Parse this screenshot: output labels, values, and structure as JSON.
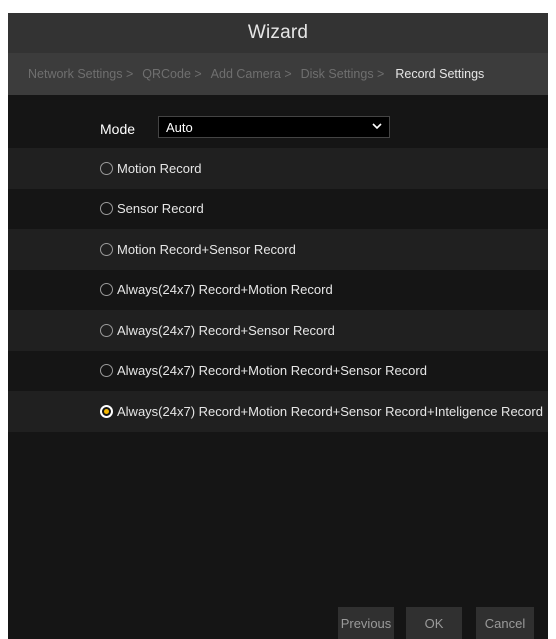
{
  "window": {
    "title": "Wizard"
  },
  "steps": [
    {
      "label": "Network Settings >"
    },
    {
      "label": "QRCode >"
    },
    {
      "label": "Add Camera >"
    },
    {
      "label": "Disk Settings >"
    },
    {
      "label": "Record Settings"
    }
  ],
  "mode": {
    "label": "Mode",
    "value": "Auto"
  },
  "options": [
    {
      "label": "Motion Record",
      "checked": false
    },
    {
      "label": "Sensor Record",
      "checked": false
    },
    {
      "label": "Motion Record+Sensor Record",
      "checked": false
    },
    {
      "label": "Always(24x7) Record+Motion Record",
      "checked": false
    },
    {
      "label": "Always(24x7) Record+Sensor Record",
      "checked": false
    },
    {
      "label": "Always(24x7) Record+Motion Record+Sensor Record",
      "checked": false
    },
    {
      "label": "Always(24x7) Record+Motion Record+Sensor Record+Inteligence Record",
      "checked": true
    }
  ],
  "buttons": {
    "previous": "Previous",
    "ok": "OK",
    "cancel": "Cancel"
  },
  "colors": {
    "accent": "#f5b800"
  }
}
